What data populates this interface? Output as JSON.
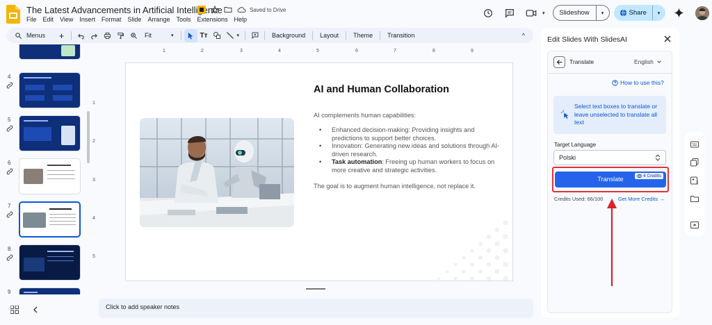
{
  "doc": {
    "title": "The Latest Advancements in Artificial Intelligence",
    "saved_status": "Saved to Drive"
  },
  "menu": [
    "File",
    "Edit",
    "View",
    "Insert",
    "Format",
    "Slide",
    "Arrange",
    "Tools",
    "Extensions",
    "Help"
  ],
  "header": {
    "slideshow_label": "Slideshow",
    "share_label": "Share"
  },
  "toolbar": {
    "menus_label": "Menus",
    "zoom_label": "Fit",
    "background_label": "Background",
    "layout_label": "Layout",
    "theme_label": "Theme",
    "transition_label": "Transition"
  },
  "filmstrip": {
    "slides": [
      {
        "number": "4"
      },
      {
        "number": "5"
      },
      {
        "number": "6"
      },
      {
        "number": "7"
      },
      {
        "number": "8"
      },
      {
        "number": "9"
      }
    ]
  },
  "ruler": {
    "ticks": [
      "1",
      "2",
      "3",
      "4",
      "5",
      "6",
      "7",
      "8",
      "9"
    ]
  },
  "ruler_v": {
    "ticks": [
      "1",
      "2",
      "3",
      "4",
      "5"
    ]
  },
  "slide": {
    "title": "AI and Human Collaboration",
    "intro": "AI complements human capabilities:",
    "bullet1": "Enhanced decision-making: Providing insights and predictions to support better choices.",
    "bullet2": "Innovation: Generating new ideas and solutions through AI-driven research.",
    "bullet3_bold": "Task automation",
    "bullet3_rest": ": Freeing up human workers to focus on more creative and strategic activities.",
    "outro": "The goal is to augment human intelligence, not replace it."
  },
  "notes": {
    "placeholder": "Click to add speaker notes"
  },
  "panel": {
    "title": "Edit Slides With SlidesAI",
    "header_label": "Translate",
    "language_dropdown": "English",
    "howto_link": "How to use this?",
    "info_text": "Select text boxes to translate or leave unselected to translate all text",
    "target_label": "Target Language",
    "target_value": "Polski",
    "translate_button": "Translate",
    "credit_badge": "4  Credits",
    "credits_used": "Credits Used: 66/100",
    "get_more": "Get More Credits"
  },
  "colors": {
    "accent": "#2563eb",
    "highlight": "#e0313a",
    "share_bg": "#c2e7ff"
  }
}
